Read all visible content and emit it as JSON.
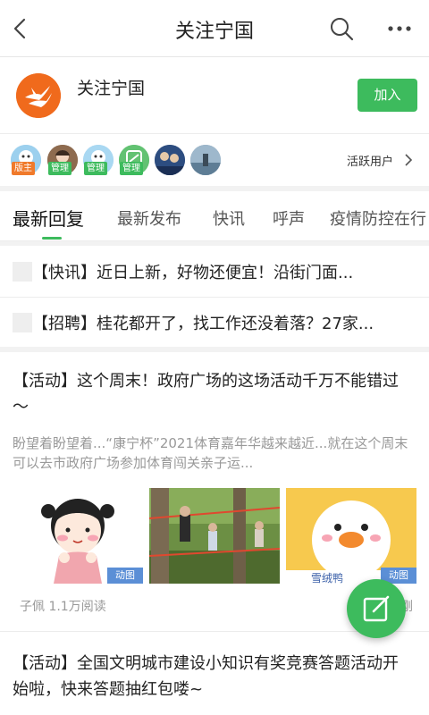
{
  "header": {
    "title": "关注宁国",
    "back_icon": "chevron-left-icon",
    "search_icon": "search-icon",
    "more_icon": "more-horizontal-icon"
  },
  "group": {
    "name": "关注宁国",
    "join_label": "加入",
    "brand_color": "#f06a1c",
    "accent_color": "#3dbb5d"
  },
  "members": {
    "roles": [
      "版主",
      "管理",
      "管理",
      "管理"
    ],
    "active_users_label": "活跃用户"
  },
  "tabs": [
    {
      "label": "最新回复",
      "active": true
    },
    {
      "label": "最新发布",
      "active": false
    },
    {
      "label": "快讯",
      "active": false
    },
    {
      "label": "呼声",
      "active": false
    },
    {
      "label": "疫情防控在行",
      "active": false
    }
  ],
  "pinned": [
    {
      "text": "【快讯】近日上新，好物还便宜！沿街门面..."
    },
    {
      "text": "【招聘】桂花都开了，找工作还没着落？27家..."
    }
  ],
  "posts": [
    {
      "title": "【活动】这个周末！政府广场的这场活动千万不能错过～",
      "excerpt": "盼望着盼望着...“康宁杯”2021体育嘉年华越来越近...就在这个周末可以去市政府广场参加体育闯关亲子运...",
      "thumbs": [
        {
          "badge": "动图"
        },
        {
          "badge": ""
        },
        {
          "badge": "动图",
          "caption": "雪绒鸭"
        }
      ],
      "author": "子佩",
      "views": "1.1万阅读",
      "time": "刚"
    },
    {
      "title": "【活动】全国文明城市建设小知识有奖竞赛答题活动开始啦，快来答题抽红包喽~"
    }
  ],
  "fab": {
    "icon": "compose-icon"
  }
}
